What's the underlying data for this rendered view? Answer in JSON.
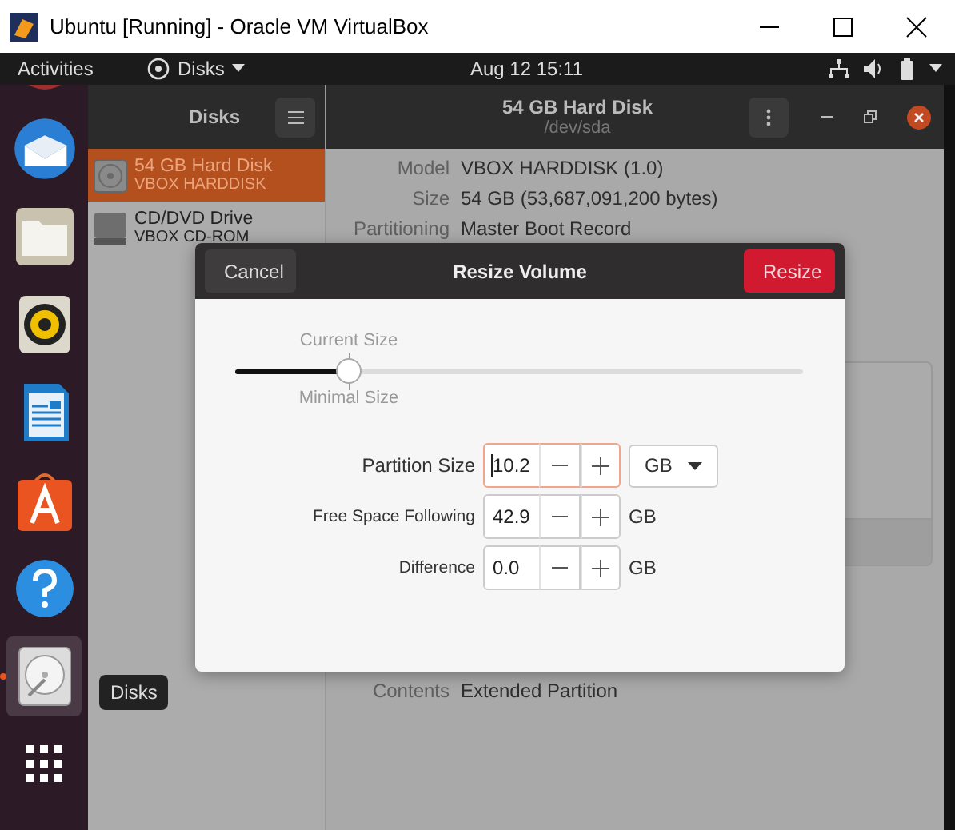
{
  "window": {
    "title": "Ubuntu [Running] - Oracle VM VirtualBox"
  },
  "top_bar": {
    "activities": "Activities",
    "app_menu": "Disks",
    "clock": "Aug 12  15:11"
  },
  "dock": [
    {
      "kind": "partial",
      "running": false
    },
    {
      "kind": "mail",
      "running": false
    },
    {
      "kind": "files",
      "running": false
    },
    {
      "kind": "speaker",
      "running": false
    },
    {
      "kind": "writer",
      "running": false
    },
    {
      "kind": "store",
      "running": false
    },
    {
      "kind": "help",
      "running": false
    },
    {
      "kind": "disk",
      "running": true
    },
    {
      "kind": "grid",
      "running": false
    }
  ],
  "dock_tooltip": "Disks",
  "sidebar": {
    "title": "Disks",
    "drives": [
      {
        "kind": "disk",
        "name": "54 GB Hard Disk",
        "model": "VBOX HARDDISK",
        "selected": true
      },
      {
        "kind": "optical",
        "name": "CD/DVD Drive",
        "model": "VBOX CD-ROM",
        "selected": false
      }
    ]
  },
  "main": {
    "title": "54 GB Hard Disk",
    "subtitle": "/dev/sda",
    "details": [
      {
        "label": "Model",
        "value": "VBOX HARDDISK (1.0)"
      },
      {
        "label": "Size",
        "value": "54 GB (53,687,091,200 bytes)"
      },
      {
        "label": "Partitioning",
        "value": "Master Boot Record"
      }
    ],
    "volume_details": [
      {
        "label": "Contents",
        "value": "Extended Partition"
      }
    ]
  },
  "dialog": {
    "title": "Resize Volume",
    "cancel": "Cancel",
    "confirm": "Resize",
    "slider": {
      "label_above": "Current Size",
      "label_below": "Minimal Size",
      "level": 0.2
    },
    "fields": [
      {
        "label": "Partition Size",
        "value": "10.2",
        "focused": true,
        "dropdown": true,
        "unit": "GB"
      },
      {
        "label": "Free Space Following",
        "value": "42.9",
        "focused": false,
        "dropdown": false,
        "unit": "GB"
      },
      {
        "label": "Difference",
        "value": "0.0",
        "focused": false,
        "dropdown": false,
        "unit": "GB"
      }
    ]
  }
}
